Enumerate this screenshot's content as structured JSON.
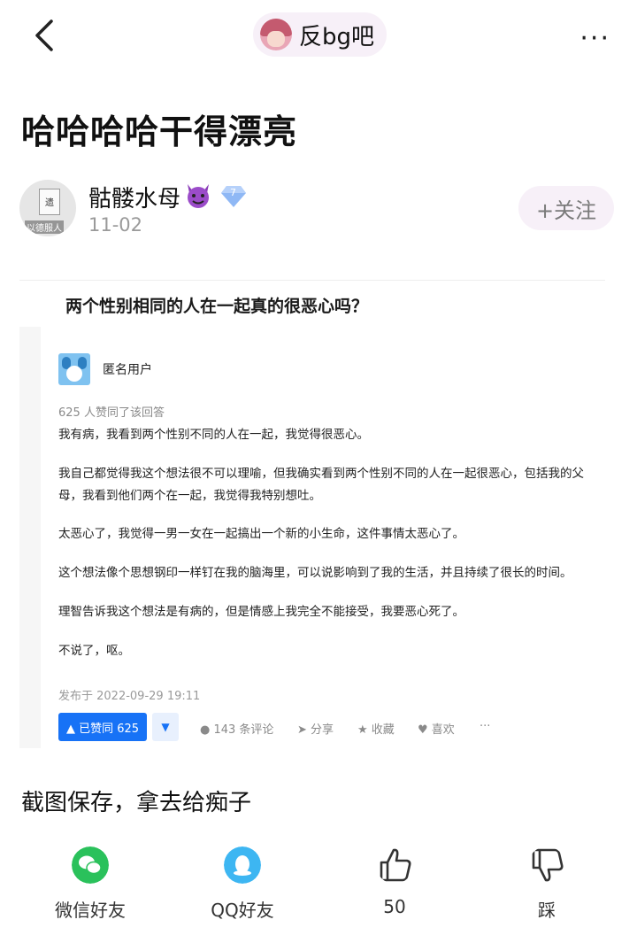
{
  "topbar": {
    "forum_name": "反bg吧",
    "more_label": "···"
  },
  "post": {
    "title": "哈哈哈哈干得漂亮",
    "author": "骷髅水母",
    "author_level": "7",
    "date": "11-02",
    "follow_label": "+关注",
    "avatar_sign_text": "遗",
    "avatar_caption": "以德服人",
    "caption": "截图保存，拿去给痴子"
  },
  "screenshot": {
    "question_title": "两个性别相同的人在一起真的很恶心吗？",
    "answerer": "匿名用户",
    "likes_line": "625 人赞同了该回答",
    "paragraphs": [
      "我有病，我看到两个性别不同的人在一起，我觉得很恶心。",
      "我自己都觉得我这个想法很不可以理喻，但我确实看到两个性别不同的人在一起很恶心，包括我的父母，我看到他们两个在一起，我觉得我特别想吐。",
      "太恶心了，我觉得一男一女在一起搞出一个新的小生命，这件事情太恶心了。",
      "这个想法像个思想钢印一样钉在我的脑海里，可以说影响到了我的生活，并且持续了很长的时间。",
      "理智告诉我这个想法是有病的，但是情感上我完全不能接受，我要恶心死了。",
      "不说了，呕。"
    ],
    "published": "发布于 2022-09-29 19:11",
    "agree_label": "▲ 已赞同 625",
    "down_label": "▼",
    "comments": "143 条评论",
    "share": "分享",
    "favorite": "收藏",
    "like": "喜欢",
    "more": "···"
  },
  "bottom_bar": {
    "wechat": "微信好友",
    "qq": "QQ好友",
    "like_count": "50",
    "dislike": "踩"
  },
  "colors": {
    "accent": "#1772f6",
    "wechat": "#2ac15b",
    "qq": "#3db6f2",
    "pill_bg": "#f7f0f8"
  }
}
